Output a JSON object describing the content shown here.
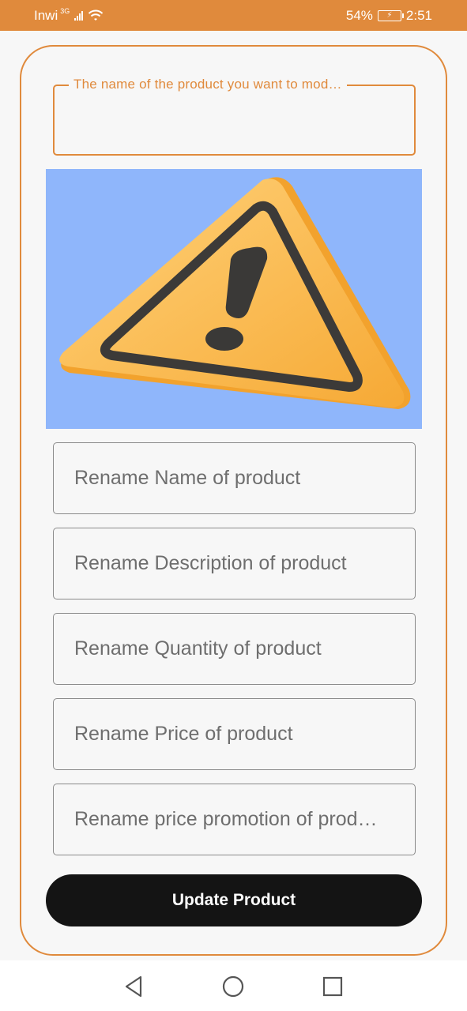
{
  "status_bar": {
    "carrier": "Inwi",
    "network": "3G",
    "battery_percent": "54%",
    "time": "2:51",
    "icons": [
      "signal-icon",
      "wifi-icon",
      "battery-charging-icon"
    ]
  },
  "form": {
    "product_name_label": "The name of the product you want to mod…",
    "product_name_value": "",
    "image_alt": "warning-triangle-image",
    "fields": [
      {
        "placeholder": "Rename Name of product",
        "value": ""
      },
      {
        "placeholder": "Rename Description of product",
        "value": ""
      },
      {
        "placeholder": "Rename Quantity of product",
        "value": ""
      },
      {
        "placeholder": "Rename Price of product",
        "value": ""
      },
      {
        "placeholder": "Rename price promotion of prod…",
        "value": ""
      }
    ],
    "submit_label": "Update Product"
  },
  "nav_bar": {
    "icons": [
      "back-icon",
      "home-icon",
      "recents-icon"
    ]
  },
  "colors": {
    "accent": "#e08a3c",
    "button": "#141414",
    "image_bg": "#8fb6fb",
    "warning_yellow": "#fbb94a"
  }
}
